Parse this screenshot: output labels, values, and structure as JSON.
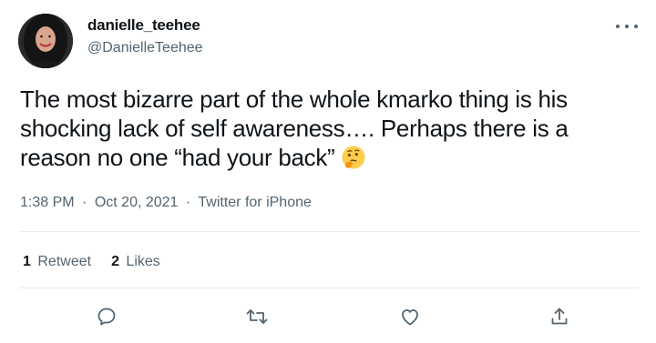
{
  "user": {
    "display_name": "danielle_teehee",
    "handle": "@DanielleTeehee",
    "avatar_icon": "profile-photo"
  },
  "tweet": {
    "text": "The most bizarre part of the whole kmarko thing is his shocking lack of self awareness…. Perhaps there is a reason no one “had your back”",
    "emoji": "thinking-face-emoji",
    "time": "1:38 PM",
    "separator": "·",
    "date": "Oct 20, 2021",
    "source": "Twitter for iPhone"
  },
  "stats": {
    "retweets_count": "1",
    "retweets_label": "Retweet",
    "likes_count": "2",
    "likes_label": "Likes"
  },
  "actions": {
    "reply_icon": "reply-icon",
    "retweet_icon": "retweet-icon",
    "like_icon": "like-heart-icon",
    "share_icon": "share-icon"
  },
  "colors": {
    "text_primary": "#0f1419",
    "text_secondary": "#536471",
    "divider": "#e6ecf0"
  }
}
